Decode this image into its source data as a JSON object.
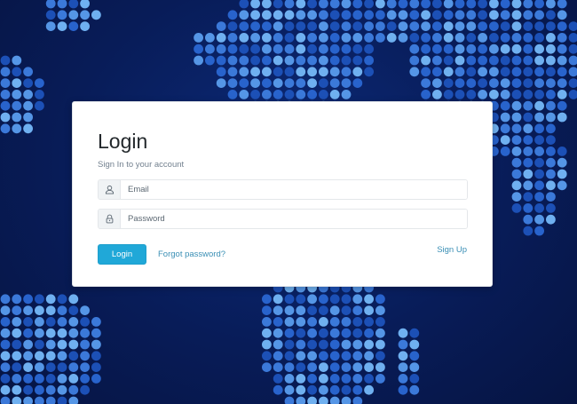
{
  "login": {
    "title": "Login",
    "subtitle": "Sign In to your account",
    "email": {
      "placeholder": "Email",
      "value": "",
      "icon": "user-icon"
    },
    "password": {
      "placeholder": "Password",
      "value": "",
      "icon": "lock-icon"
    },
    "submit_label": "Login",
    "forgot_label": "Forgot password?",
    "signup_label": "Sign Up"
  },
  "colors": {
    "background": "#081c58",
    "dot_palette": [
      "#1c50b6",
      "#2863cc",
      "#3b79d9",
      "#5596e6",
      "#6fb0f0"
    ],
    "primary_button": "#20a8d8",
    "link": "#3a8fb5"
  }
}
